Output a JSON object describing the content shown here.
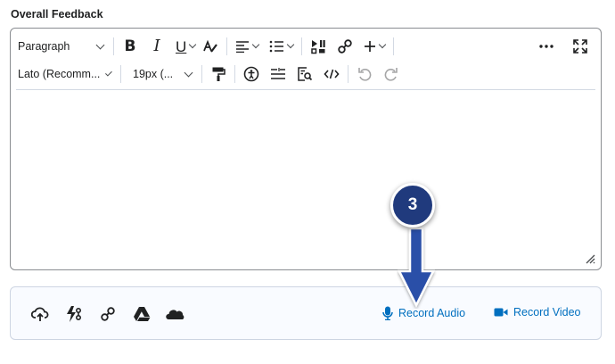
{
  "section": {
    "title": "Overall Feedback"
  },
  "toolbar": {
    "block_format": "Paragraph",
    "font_family": "Lato (Recomm...",
    "font_size": "19px (..."
  },
  "attachments": {
    "icons": [
      "upload-cloud-icon",
      "quicklink-icon",
      "link-icon",
      "google-drive-icon",
      "onedrive-icon"
    ],
    "record_audio_label": "Record Audio",
    "record_video_label": "Record Video"
  },
  "callout": {
    "step": "3"
  },
  "colors": {
    "link": "#006fbf",
    "callout": "#203a7d",
    "arrow": "#2b4fa8",
    "border": "#8a8d91",
    "attach_bg": "#f9fbff"
  }
}
